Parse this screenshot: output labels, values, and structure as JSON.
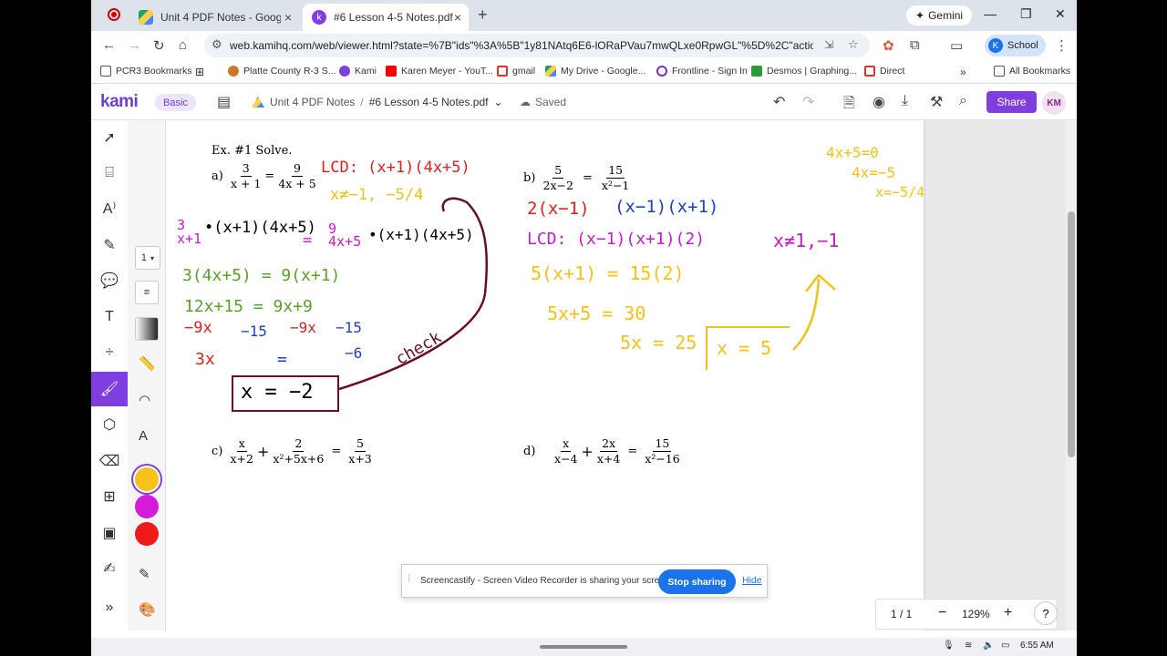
{
  "browser": {
    "tabs": [
      {
        "title": "Unit 4 PDF Notes - Google Drive",
        "icon": "drive-icon"
      },
      {
        "title": "#6 Lesson 4-5 Notes.pdf",
        "icon": "kami-icon"
      }
    ],
    "gemini_label": "Gemini",
    "url": "web.kamihq.com/web/viewer.html?state=%7B\"ids\"%3A%5B\"1y81NAtq6E6-lORaPVau7mwQLxe0RpwGL\"%5D%2C\"action\"%3A\"ope...",
    "profile_initial": "K",
    "profile_label": "School",
    "bookmarks": [
      "PCR3 Bookmarks",
      "Platte County R-3 S...",
      "Kami",
      "Karen Meyer - YouT...",
      "gmail",
      "My Drive - Google...",
      "Frontline - Sign In",
      "Desmos | Graphing...",
      "Direct"
    ],
    "all_bookmarks": "All Bookmarks"
  },
  "kami": {
    "logo": "kami",
    "plan": "Basic",
    "folder": "Unit 4 PDF Notes",
    "separator": "/",
    "file": "#6 Lesson 4-5 Notes.pdf",
    "status": "Saved",
    "share": "Share",
    "avatar": "KM",
    "stroke_size": "1",
    "colors": {
      "yellow": "#f7c21a",
      "magenta": "#d51bd8",
      "red": "#ee1b1b",
      "accent": "#7f3fe0"
    }
  },
  "doc": {
    "heading": "Ex. #1 Solve.",
    "a_label": "a)",
    "a_eq": {
      "n1": "3",
      "d1": "x + 1",
      "eq": "=",
      "n2": "9",
      "d2": "4x + 5"
    },
    "b_label": "b)",
    "b_eq": {
      "n1": "5",
      "d1": "2x−2",
      "eq": "=",
      "n2": "15",
      "d2": "x²−1"
    },
    "c_label": "c)",
    "c_eq": {
      "n1": "x",
      "d1": "x+2",
      "plus": "+",
      "n2": "2",
      "d2": "x²+5x+6",
      "eq": "=",
      "n3": "5",
      "d3": "x+3"
    },
    "d_label": "d)",
    "d_eq": {
      "n1": "x",
      "d1": "x−4",
      "plus": "+",
      "n2": "2x",
      "d2": "x+4",
      "eq": "=",
      "n3": "15",
      "d3": "x²−16"
    },
    "ink": {
      "lcd_a": "LCD: (x+1)(4x+5)",
      "restrict_a": "x≠−1, −5/4",
      "mult_left": "•(x+1)(4x+5)",
      "mult_right": "•(x+1)(4x+5)",
      "step1": "3(4x+5) = 9(x+1)",
      "step2": "12x+15 = 9x+9",
      "step3a": "−9x",
      "step3b": "−15",
      "step3c": "−9x",
      "step3d": "−15",
      "step3e": "−6",
      "step4": "3x",
      "step4eq": "=",
      "answer_a": "x = −2",
      "check": "check",
      "side_1": "4x+5=0",
      "side_2": "4x=−5",
      "side_3": "x=−5/4",
      "factor_b1": "2(x−1)",
      "factor_b2": "(x−1)(x+1)",
      "lcd_b": "LCD: (x−1)(x+1)(2)",
      "restrict_b": "x≠1,−1",
      "b_step1": "5(x+1) = 15(2)",
      "b_step2": "5x+5 = 30",
      "b_step3": "5x = 25",
      "answer_b": "x = 5"
    }
  },
  "notice": {
    "message": "Screencastify - Screen Video Recorder is sharing your screen.",
    "stop": "Stop sharing",
    "hide": "Hide"
  },
  "pager": {
    "page": "1 / 1",
    "zoom": "129%",
    "help": "?"
  },
  "taskbar": {
    "time": "6:55 AM"
  }
}
